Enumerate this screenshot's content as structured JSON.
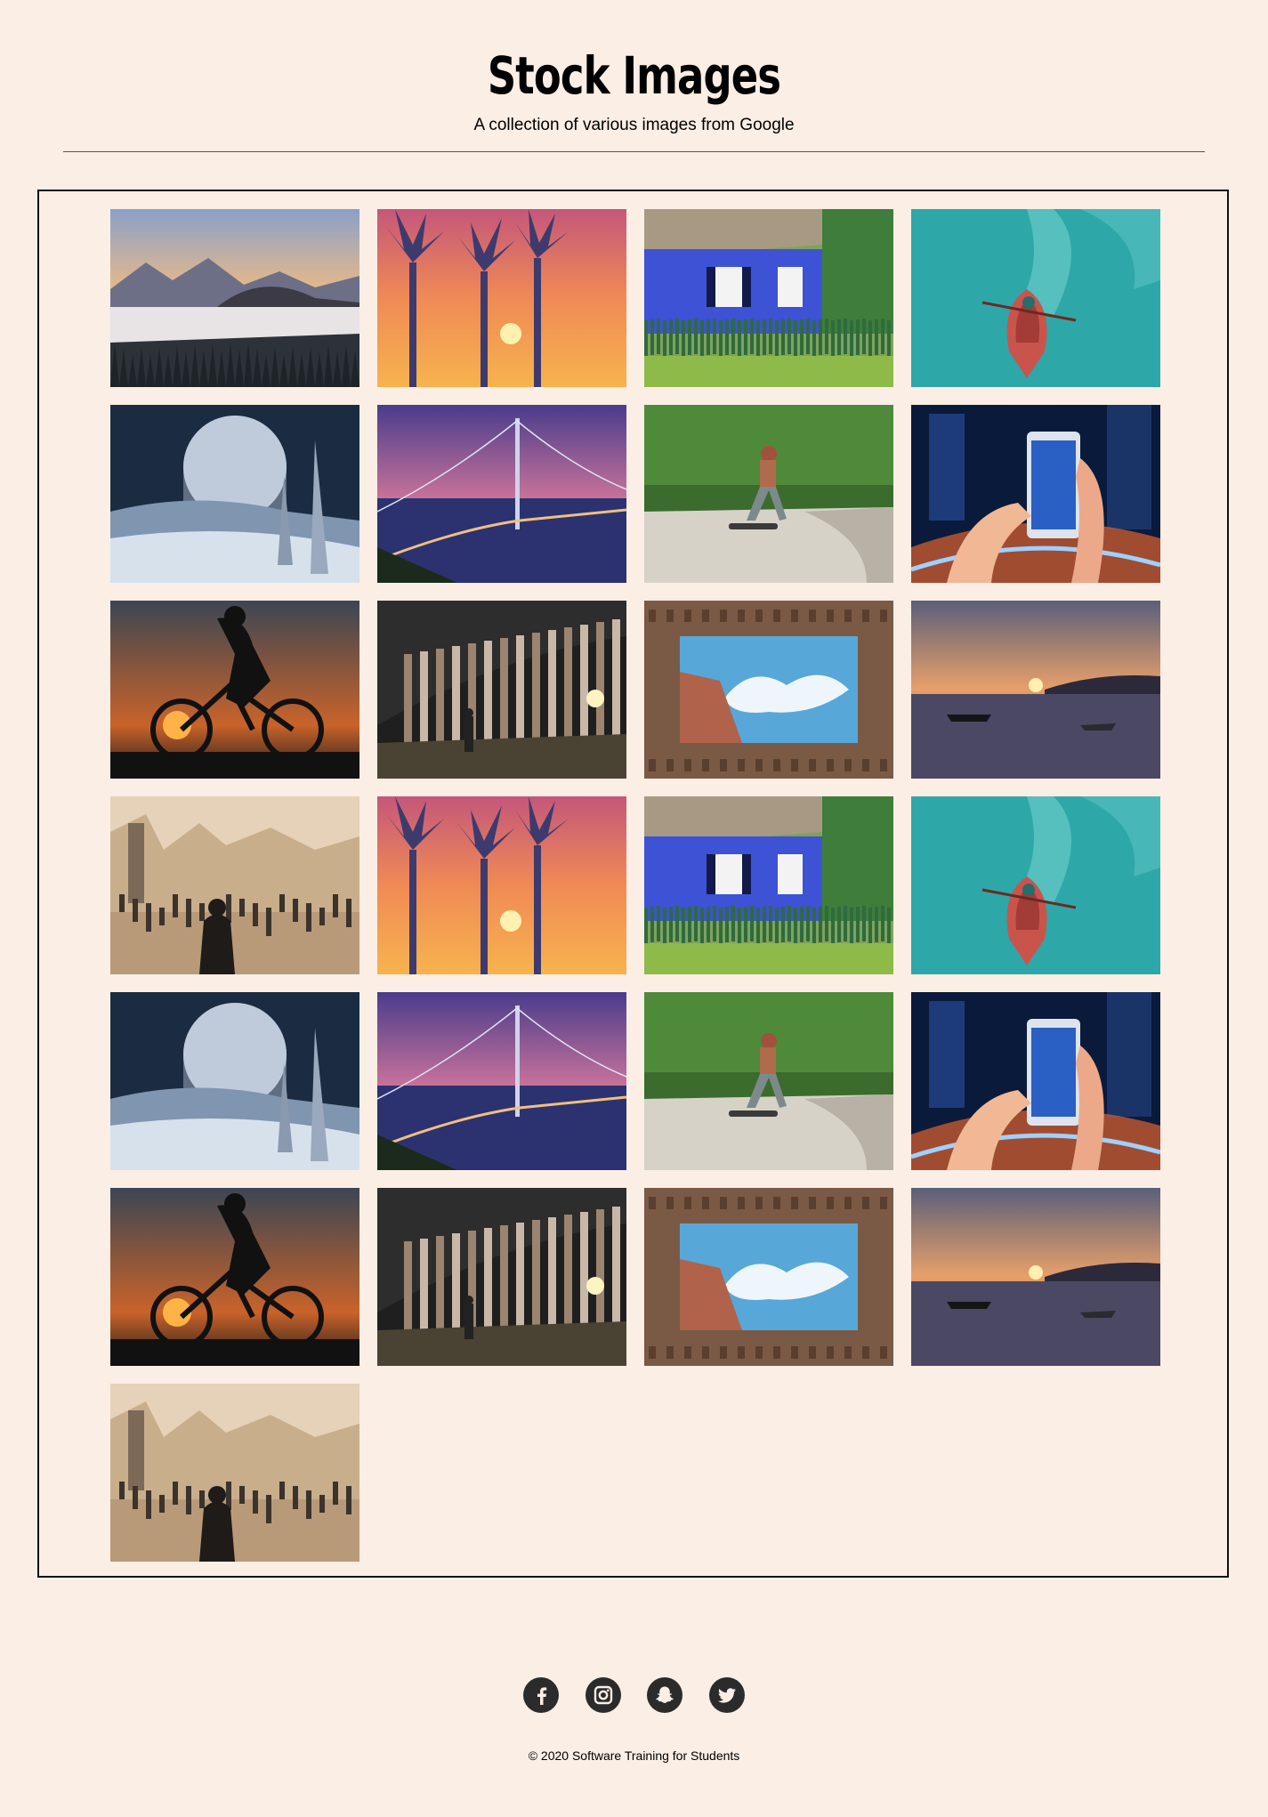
{
  "header": {
    "title": "Stock Images",
    "subtitle": "A collection of various images from Google"
  },
  "gallery": {
    "images": [
      {
        "name": "misty-mountain-lake"
      },
      {
        "name": "palm-trees-sunset"
      },
      {
        "name": "blue-cottage"
      },
      {
        "name": "red-rowboat"
      },
      {
        "name": "moon-fantasy"
      },
      {
        "name": "suspension-bridge-dusk"
      },
      {
        "name": "skateboarder"
      },
      {
        "name": "smartphone-city-lights"
      },
      {
        "name": "cyclist-silhouette"
      },
      {
        "name": "colonnade-person"
      },
      {
        "name": "courtyard-sky"
      },
      {
        "name": "lake-sunset-boats"
      },
      {
        "name": "prague-bridge-morning"
      },
      {
        "name": "palm-trees-sunset"
      },
      {
        "name": "blue-cottage"
      },
      {
        "name": "red-rowboat"
      },
      {
        "name": "moon-fantasy"
      },
      {
        "name": "suspension-bridge-dusk"
      },
      {
        "name": "skateboarder"
      },
      {
        "name": "smartphone-city-lights"
      },
      {
        "name": "cyclist-silhouette"
      },
      {
        "name": "colonnade-person"
      },
      {
        "name": "courtyard-sky"
      },
      {
        "name": "lake-sunset-boats"
      },
      {
        "name": "prague-bridge-morning"
      }
    ]
  },
  "social": [
    {
      "icon": "facebook-icon"
    },
    {
      "icon": "instagram-icon"
    },
    {
      "icon": "snapchat-icon"
    },
    {
      "icon": "twitter-icon"
    }
  ],
  "footer": {
    "copyright": "© 2020 Software Training for Students"
  },
  "colors": {
    "background": "#faeee5",
    "border": "#111111",
    "icon_bg": "#2b2b2b"
  }
}
